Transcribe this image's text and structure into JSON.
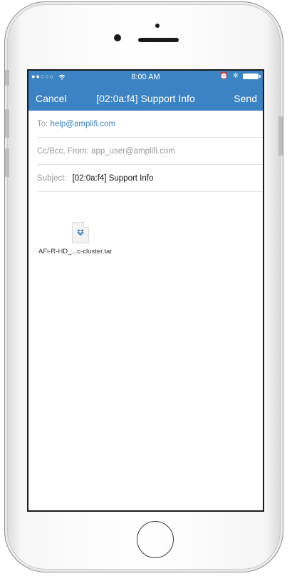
{
  "status": {
    "signal": "●●○○○",
    "wifi": "wifi-icon",
    "time": "8:00 AM",
    "alarm": "alarm-icon",
    "bluetooth": "bluetooth-icon",
    "battery": "battery-icon"
  },
  "nav": {
    "cancel": "Cancel",
    "title": "[02:0a:f4] Support Info",
    "send": "Send"
  },
  "compose": {
    "to_label": "To:",
    "to_value": "help@amplifi.com",
    "cc_label": "Cc/Bcc, From:",
    "cc_value": "app_user@amplifi.com",
    "subject_label": "Subject:",
    "subject_value": "[02:0a:f4] Support Info"
  },
  "attachment": {
    "filename": "AFi-R-HD_...c-cluster.tar",
    "icon": "dropbox-icon"
  },
  "colors": {
    "accent": "#3c83c4"
  }
}
